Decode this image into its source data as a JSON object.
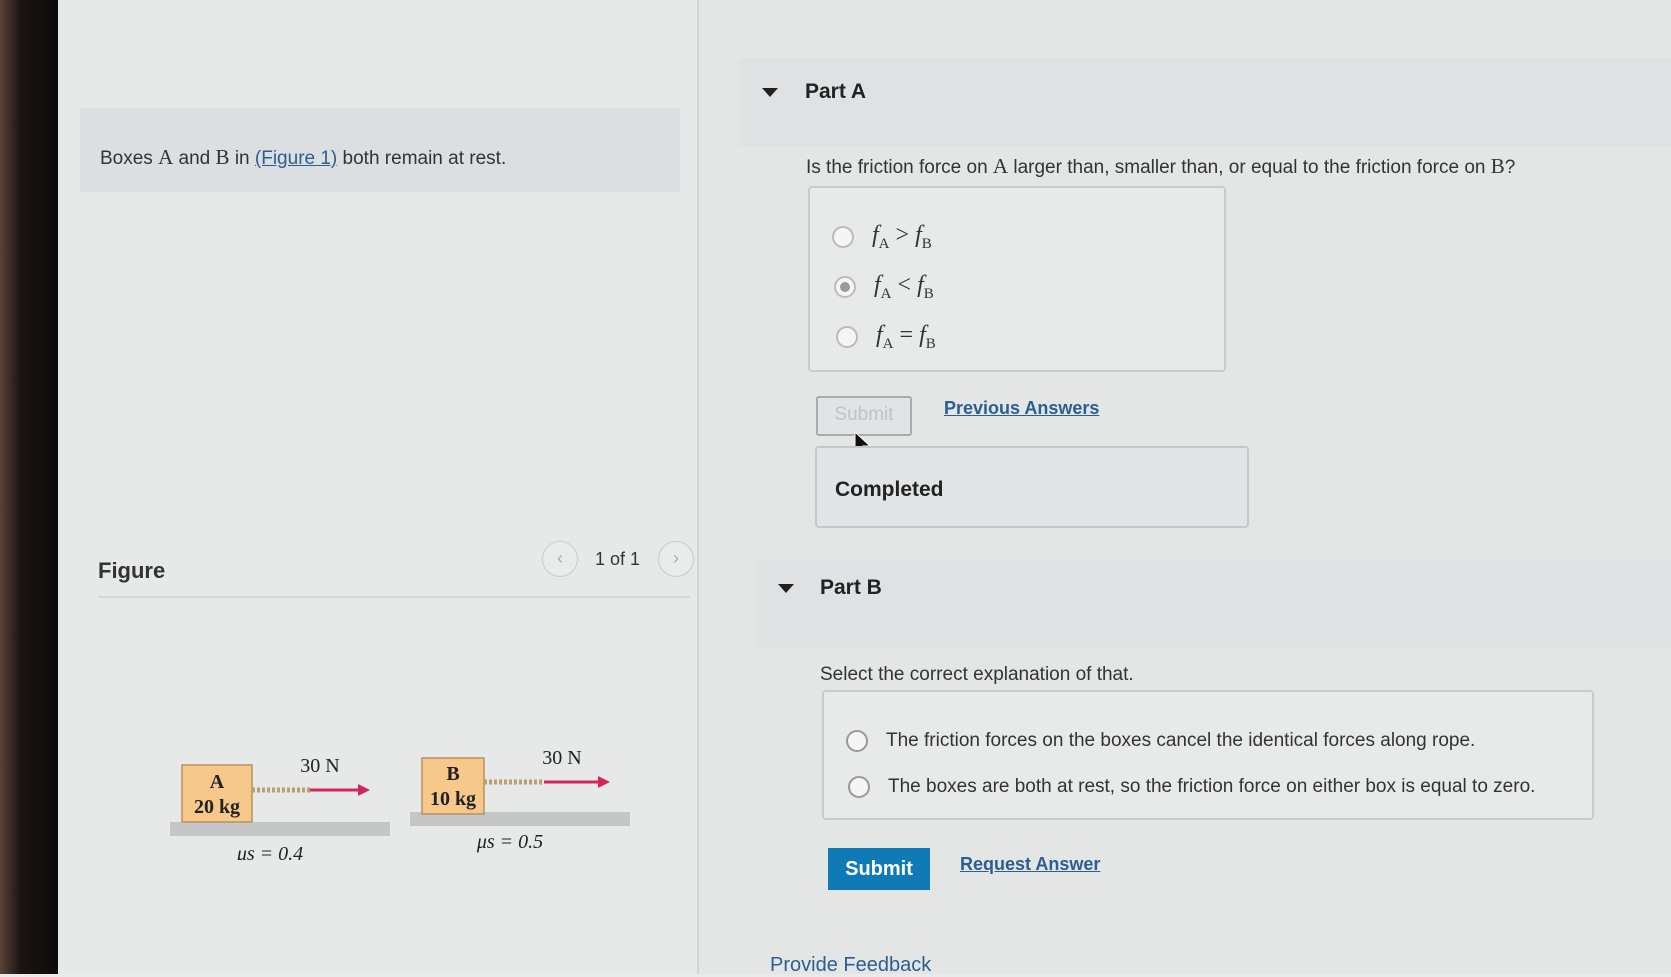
{
  "intro": {
    "text_1": "Boxes ",
    "box_a": "A",
    "text_2": " and ",
    "box_b": "B",
    "text_3": " in ",
    "figure_link": "(Figure 1)",
    "text_4": " both remain at rest."
  },
  "figure": {
    "title": "Figure",
    "pager": "1 of 1",
    "prev_icon": "chevron-left-icon",
    "next_icon": "chevron-right-icon",
    "box_a": {
      "name": "A",
      "mass": "20 kg",
      "force": "30 N",
      "mu": "μs = 0.4"
    },
    "box_b": {
      "name": "B",
      "mass": "10 kg",
      "force": "30 N",
      "mu": "μs = 0.5"
    }
  },
  "part_a": {
    "title": "Part A",
    "question_1": "Is the friction force on ",
    "question_a": "A",
    "question_2": " larger than, smaller than, or equal to the friction force on ",
    "question_b": "B",
    "question_3": "?",
    "options": [
      {
        "lhs": "f",
        "lhs_sub": "A",
        "op": ">",
        "rhs": "f",
        "rhs_sub": "B",
        "selected": false
      },
      {
        "lhs": "f",
        "lhs_sub": "A",
        "op": "<",
        "rhs": "f",
        "rhs_sub": "B",
        "selected": true
      },
      {
        "lhs": "f",
        "lhs_sub": "A",
        "op": "=",
        "rhs": "f",
        "rhs_sub": "B",
        "selected": false
      }
    ],
    "submit_label": "Submit",
    "previous_answers": "Previous Answers",
    "status": "Completed"
  },
  "part_b": {
    "title": "Part B",
    "question": "Select the correct explanation of that.",
    "options": [
      "The friction forces on the boxes cancel the identical forces along rope.",
      "The boxes are both at rest, so the friction force on either box is equal to zero."
    ],
    "submit_label": "Submit",
    "request_answer": "Request Answer"
  },
  "feedback": "Provide Feedback",
  "colors": {
    "submit_bg": "#0f7ab5",
    "link": "#2a5f8f",
    "arrow": "#d0285a",
    "box_fill": "#f6c98a"
  }
}
